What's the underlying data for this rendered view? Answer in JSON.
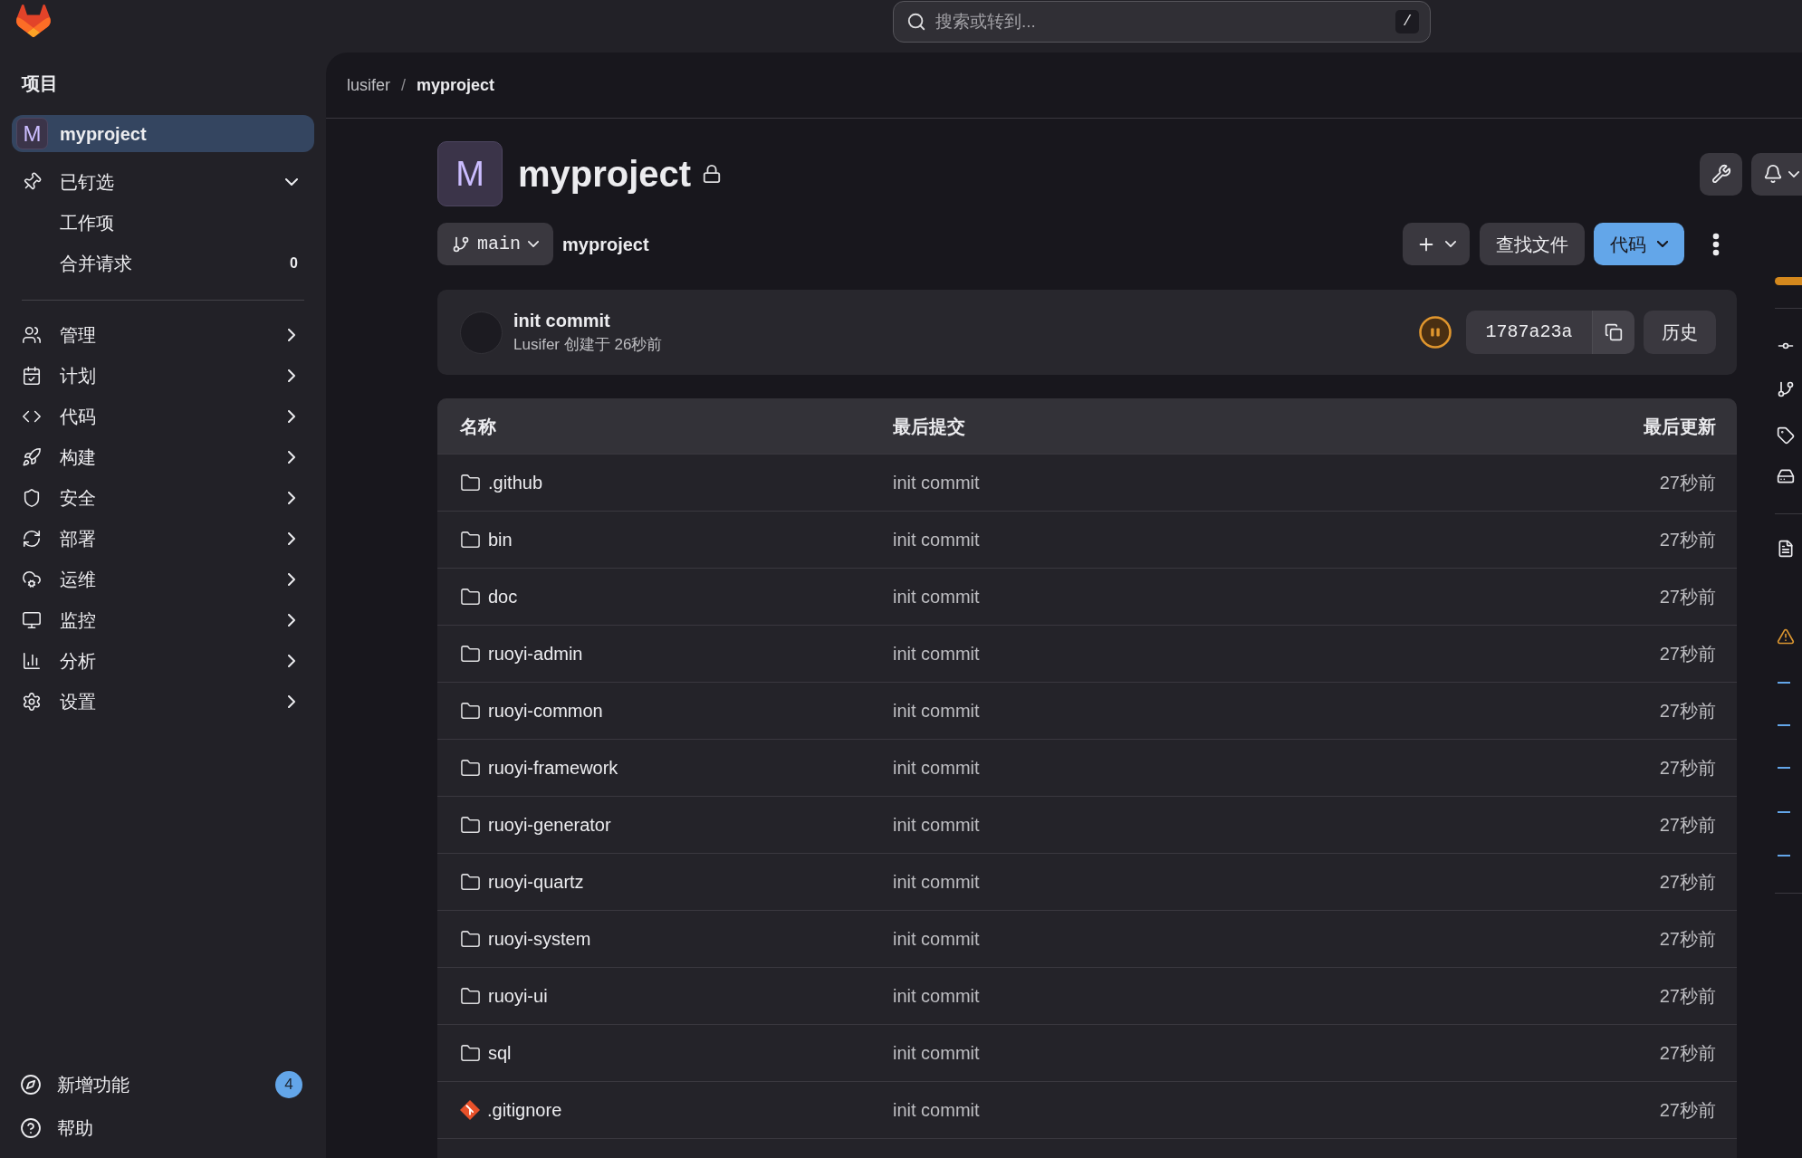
{
  "top_bar": {
    "search": {
      "placeholder": "搜索或转到...",
      "shortcut": "/"
    }
  },
  "sidebar": {
    "heading": "项目",
    "project": {
      "avatar": "M",
      "name": "myproject",
      "selected": true
    },
    "pinned": {
      "label": "已钉选",
      "expanded": true,
      "items": [
        {
          "label": "工作项"
        },
        {
          "label": "合并请求",
          "count": "0"
        }
      ]
    },
    "items": [
      {
        "label": "管理",
        "expanded": false
      },
      {
        "label": "计划",
        "expanded": false
      },
      {
        "label": "代码",
        "expanded": false
      },
      {
        "label": "构建",
        "expanded": false
      },
      {
        "label": "安全",
        "expanded": false
      },
      {
        "label": "部署",
        "expanded": false
      },
      {
        "label": "运维",
        "expanded": false
      },
      {
        "label": "监控",
        "expanded": false
      },
      {
        "label": "分析",
        "expanded": false
      },
      {
        "label": "设置",
        "expanded": false
      }
    ],
    "footer": [
      {
        "label": "新增功能",
        "badge": "4"
      },
      {
        "label": "帮助"
      }
    ]
  },
  "breadcrumb": {
    "items": [
      "lusifer",
      "myproject"
    ],
    "separator": "/"
  },
  "project": {
    "avatar": "M",
    "title": "myproject",
    "private": true
  },
  "repository": {
    "branch": "main",
    "path": "myproject",
    "find_file_button": "查找文件",
    "code_button": "代码"
  },
  "commit": {
    "title": "init commit",
    "meta": "Lusifer 创建于 26秒前",
    "pipeline": {
      "kind": "pending"
    },
    "sha": "1787a23a",
    "history_button": "历史"
  },
  "table": {
    "columns": [
      "名称",
      "最后提交",
      "最后更新"
    ],
    "rows": [
      {
        "kind": "folder",
        "name": ".github",
        "commit": "init commit",
        "updated": "27秒前"
      },
      {
        "kind": "folder",
        "name": "bin",
        "commit": "init commit",
        "updated": "27秒前"
      },
      {
        "kind": "folder",
        "name": "doc",
        "commit": "init commit",
        "updated": "27秒前"
      },
      {
        "kind": "folder",
        "name": "ruoyi-admin",
        "commit": "init commit",
        "updated": "27秒前"
      },
      {
        "kind": "folder",
        "name": "ruoyi-common",
        "commit": "init commit",
        "updated": "27秒前"
      },
      {
        "kind": "folder",
        "name": "ruoyi-framework",
        "commit": "init commit",
        "updated": "27秒前"
      },
      {
        "kind": "folder",
        "name": "ruoyi-generator",
        "commit": "init commit",
        "updated": "27秒前"
      },
      {
        "kind": "folder",
        "name": "ruoyi-quartz",
        "commit": "init commit",
        "updated": "27秒前"
      },
      {
        "kind": "folder",
        "name": "ruoyi-system",
        "commit": "init commit",
        "updated": "27秒前"
      },
      {
        "kind": "folder",
        "name": "ruoyi-ui",
        "commit": "init commit",
        "updated": "27秒前"
      },
      {
        "kind": "folder",
        "name": "sql",
        "commit": "init commit",
        "updated": "27秒前"
      },
      {
        "kind": "git-file",
        "name": ".gitignore",
        "commit": "init commit",
        "updated": "27秒前"
      }
    ]
  }
}
